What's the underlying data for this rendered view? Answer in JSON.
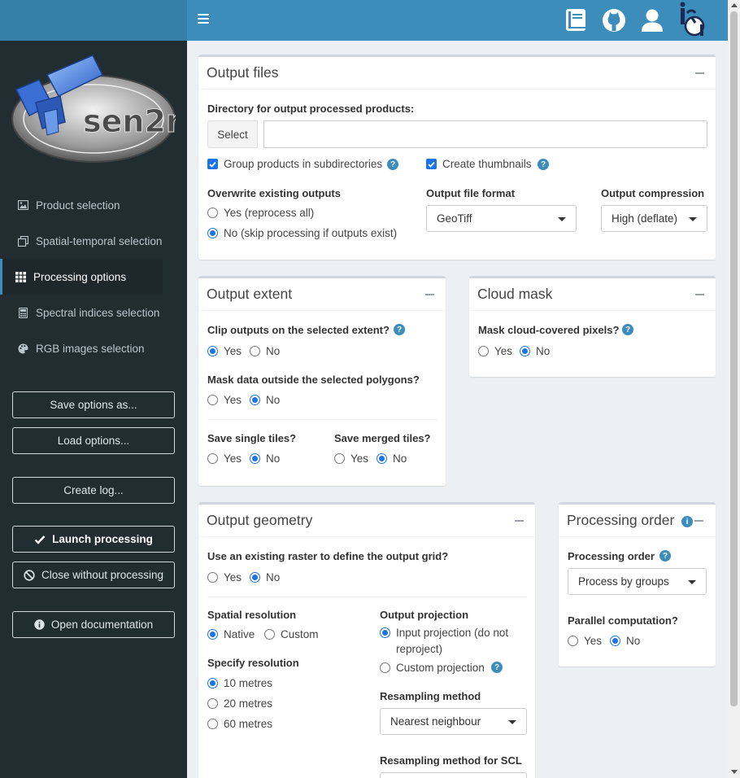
{
  "sidebar": {
    "logo_text": "sen2r",
    "nav": [
      {
        "label": "Product selection",
        "icon": "image-icon"
      },
      {
        "label": "Spatial-temporal selection",
        "icon": "clone-icon"
      },
      {
        "label": "Processing options",
        "icon": "grid-icon"
      },
      {
        "label": "Spectral indices selection",
        "icon": "calculator-icon"
      },
      {
        "label": "RGB images selection",
        "icon": "palette-icon"
      }
    ],
    "buttons": {
      "save": "Save options as...",
      "load": "Load options...",
      "log": "Create log...",
      "launch": "Launch processing",
      "close": "Close without processing",
      "docs": "Open documentation"
    }
  },
  "header": {
    "icons": [
      "book-icon",
      "github-icon",
      "user-icon",
      "irea-logo-icon"
    ]
  },
  "output_files": {
    "title": "Output files",
    "dir_label": "Directory for output processed products:",
    "select_btn": "Select",
    "dir_value": "",
    "group_label": "Group products in subdirectories",
    "thumbs_label": "Create thumbnails",
    "overwrite_label": "Overwrite existing outputs",
    "overwrite_yes": "Yes (reprocess all)",
    "overwrite_no": "No (skip processing if outputs exist)",
    "format_label": "Output file format",
    "format_value": "GeoTiff",
    "compression_label": "Output compression",
    "compression_value": "High (deflate)"
  },
  "output_extent": {
    "title": "Output extent",
    "clip_label": "Clip outputs on the selected extent?",
    "mask_label": "Mask data outside the selected polygons?",
    "single_label": "Save single tiles?",
    "merged_label": "Save merged tiles?"
  },
  "cloud_mask": {
    "title": "Cloud mask",
    "mask_label": "Mask cloud-covered pixels?"
  },
  "output_geometry": {
    "title": "Output geometry",
    "raster_label": "Use an existing raster to define the output grid?",
    "res_label": "Spatial resolution",
    "res_native": "Native",
    "res_custom": "Custom",
    "specify_label": "Specify resolution",
    "res_10": "10 metres",
    "res_20": "20 metres",
    "res_60": "60 metres",
    "proj_label": "Output projection",
    "proj_input_1": "Input projection (do not",
    "proj_input_2": "reproject)",
    "proj_custom": "Custom projection",
    "resampling_label": "Resampling method",
    "resampling_value": "Nearest neighbour",
    "resampling_scl_label": "Resampling method for SCL"
  },
  "processing_order": {
    "title": "Processing order",
    "order_label": "Processing order",
    "order_value": "Process by groups",
    "parallel_label": "Parallel computation?"
  },
  "common": {
    "yes": "Yes",
    "no": "No"
  },
  "colors": {
    "header": "#3c8dbc",
    "sidebar": "#222d32",
    "accent": "#1a73e8"
  }
}
